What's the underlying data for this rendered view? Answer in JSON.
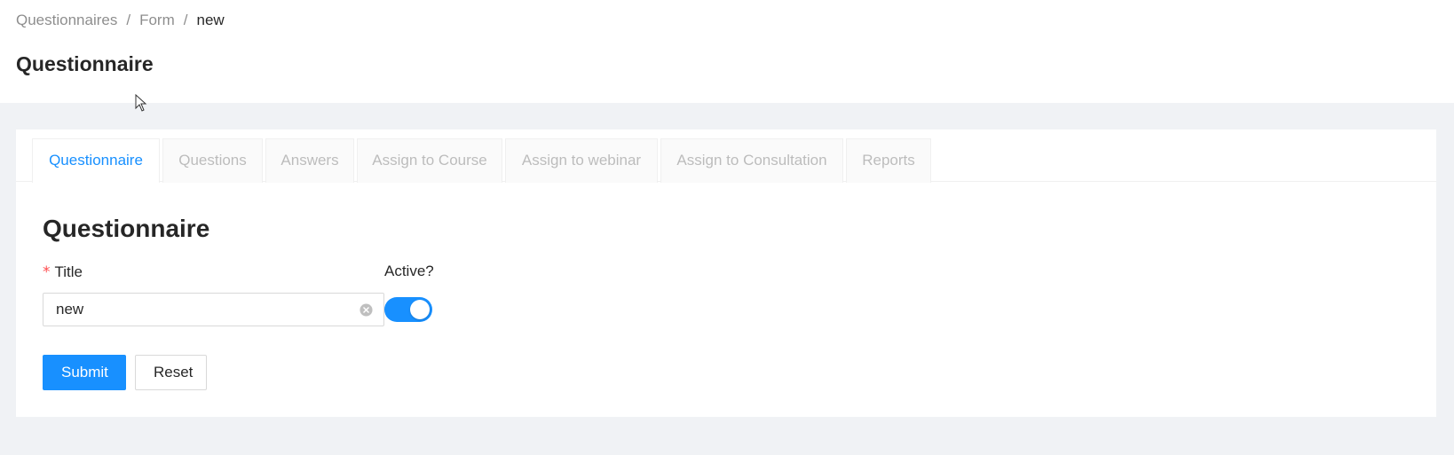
{
  "breadcrumb": {
    "items": [
      "Questionnaires",
      "Form",
      "new"
    ],
    "separator": "/"
  },
  "header": {
    "title": "Questionnaire"
  },
  "tabs": [
    {
      "label": "Questionnaire",
      "active": true
    },
    {
      "label": "Questions",
      "active": false
    },
    {
      "label": "Answers",
      "active": false
    },
    {
      "label": "Assign to Course",
      "active": false
    },
    {
      "label": "Assign to webinar",
      "active": false
    },
    {
      "label": "Assign to Consultation",
      "active": false
    },
    {
      "label": "Reports",
      "active": false
    }
  ],
  "form": {
    "heading": "Questionnaire",
    "title_label": "Title",
    "required_mark": "*",
    "title_value": "new",
    "active_label": "Active?",
    "active_on": true,
    "submit_label": "Submit",
    "reset_label": "Reset"
  },
  "icons": {
    "clear": "close-circle-icon",
    "cursor": "mouse-pointer-icon"
  },
  "colors": {
    "primary": "#1890ff",
    "required": "#ff4d4f",
    "background": "#f0f2f5"
  }
}
